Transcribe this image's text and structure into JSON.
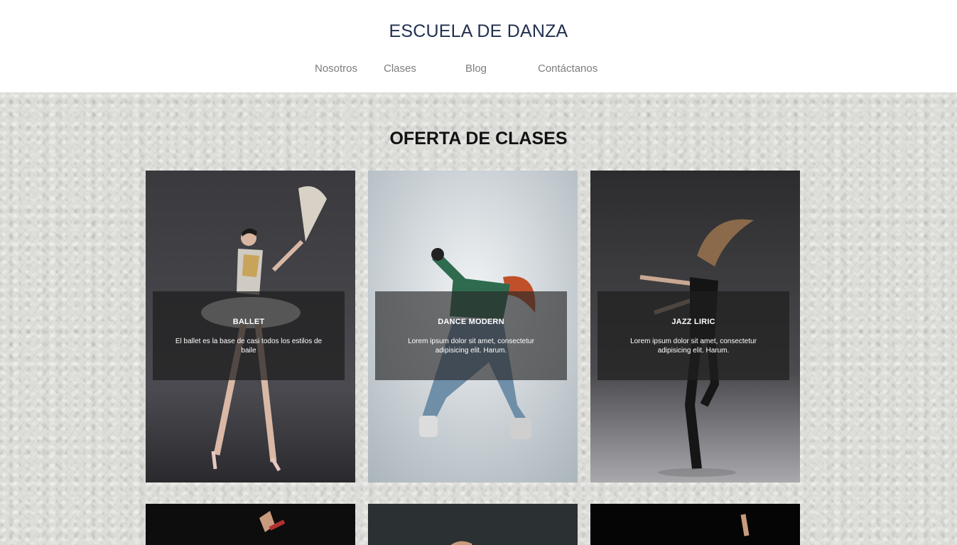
{
  "header": {
    "site_title": "ESCUELA DE DANZA",
    "nav": [
      "Nosotros",
      "Clases",
      "Blog",
      "Contáctanos"
    ]
  },
  "classes": {
    "section_title": "OFERTA DE CLASES",
    "cards": [
      {
        "title": "BALLET",
        "description": "El ballet es la base de casi todos los estilos de baile"
      },
      {
        "title": "DANCE MODERN",
        "description": "Lorem ipsum dolor sit amet, consectetur adipisicing elit. Harum."
      },
      {
        "title": "JAZZ LIRIC",
        "description": "Lorem ipsum dolor sit amet, consectetur adipisicing elit. Harum."
      }
    ]
  },
  "colors": {
    "title": "#23314f",
    "nav_text": "#7c7c7c",
    "overlay": "rgba(30,30,30,0.72)",
    "background_texture": "#dcdcd8"
  }
}
